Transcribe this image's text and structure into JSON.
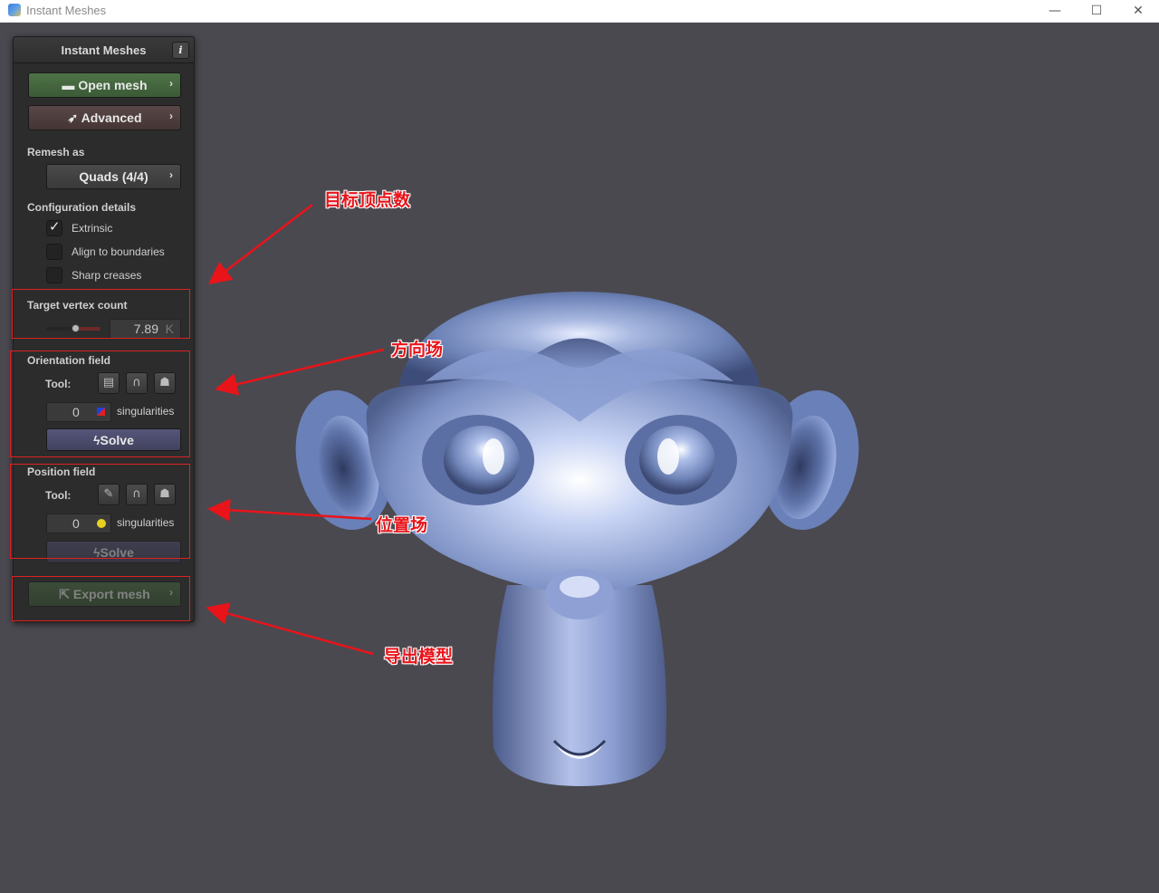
{
  "window": {
    "title": "Instant Meshes",
    "minimize": "—",
    "maximize": "☐",
    "close": "✕"
  },
  "panel": {
    "title": "Instant Meshes",
    "info": "i",
    "open_mesh": "Open mesh",
    "advanced": "Advanced",
    "remesh_as_label": "Remesh as",
    "remesh_mode": "Quads (4/4)",
    "config_label": "Configuration details",
    "checkboxes": [
      {
        "label": "Extrinsic",
        "checked": true
      },
      {
        "label": "Align to boundaries",
        "checked": false
      },
      {
        "label": "Sharp creases",
        "checked": false
      }
    ],
    "target_label": "Target vertex count",
    "target_value": "7.89",
    "target_unit": "K",
    "target_slider_fraction": 0.5,
    "orientation": {
      "label": "Orientation field",
      "tool_label": "Tool:",
      "singularities_count": "0",
      "singularities_label": "singularities",
      "solve": "Solve",
      "tools": [
        "comb-icon",
        "magnet-icon",
        "ghost-icon"
      ]
    },
    "position": {
      "label": "Position field",
      "tool_label": "Tool:",
      "singularities_count": "0",
      "singularities_label": "singularities",
      "solve": "Solve",
      "tools": [
        "brush-icon",
        "magnet-icon",
        "ghost-icon"
      ]
    },
    "export_mesh": "Export mesh"
  },
  "annotations": {
    "target_vertex": "目标顶点数",
    "orientation": "方向场",
    "position": "位置场",
    "export": "导出模型"
  },
  "colors": {
    "accent_annotation": "#e8141a",
    "mesh_color": "#7a90c0",
    "background": "#4a4950"
  }
}
